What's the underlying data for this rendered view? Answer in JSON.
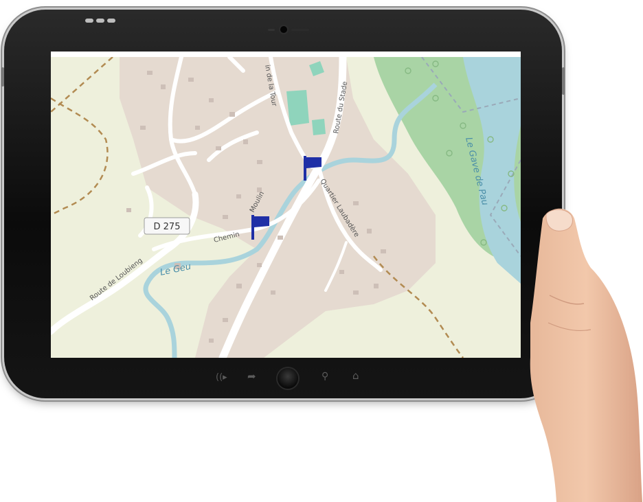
{
  "map": {
    "road_badge": "D 275",
    "labels": {
      "route_de_loubieng": "Route de Loubieng",
      "chemin_du_moulin_a": "Chemin",
      "chemin_du_moulin_b": "Moulin",
      "chemin_de_la_tour": "in de la Tour",
      "route_du_stade": "Route du Stade",
      "quartier_laubadere": "Quartier Laubadère",
      "le_geu": "Le Geu",
      "le_gave_de_pau": "Le Gave de Pau"
    },
    "markers": [
      "flag-marker",
      "flag-marker"
    ],
    "colors": {
      "land": "#eef0dc",
      "builtup": "#e3d6ce",
      "forest": "#a9d4a5",
      "river": "#a9d3dc",
      "road": "#ffffff",
      "path": "#b28b52",
      "sports": "#8fd4bc",
      "marker": "#1f2fa6",
      "label": "#555555",
      "water_label": "#4a8ea8"
    }
  },
  "device": {
    "nav_icons": [
      "sound-icon",
      "share-icon",
      "home-button",
      "search-icon",
      "house-icon"
    ]
  }
}
